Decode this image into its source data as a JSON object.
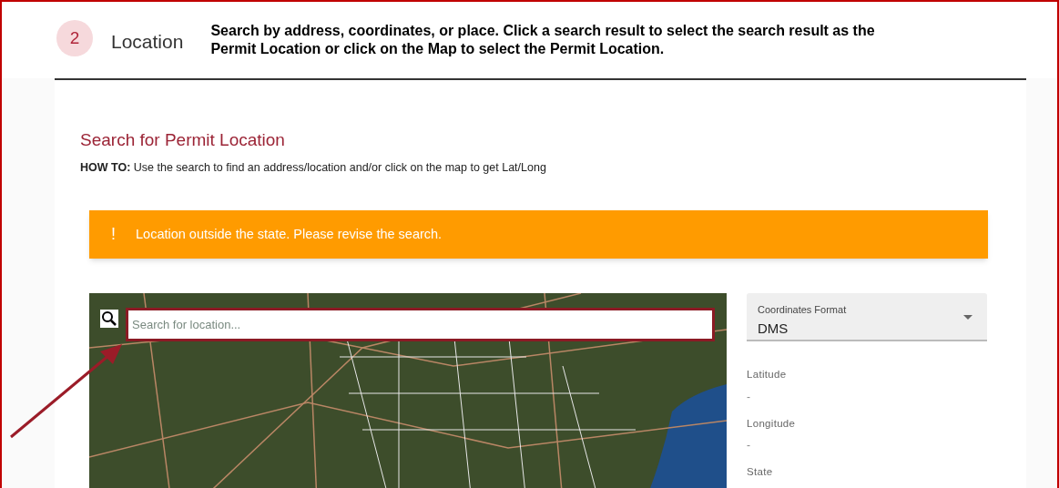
{
  "step": {
    "number": "2",
    "label": "Location"
  },
  "instructions": "Search by address, coordinates, or place. Click a search result to select the search result as the Permit Location or click on the Map to select the Permit Location.",
  "section": {
    "title": "Search for Permit Location",
    "howto": "**HOW TO:** Use the search to find an address/location and/or click on the map to get Lat/Long"
  },
  "alert": {
    "icon": "!",
    "message": "Location outside the state. Please revise the search."
  },
  "map": {
    "search": {
      "placeholder": "Search for location..."
    }
  },
  "coordinates_format": {
    "label": "Coordinates Format",
    "value": "DMS"
  },
  "fields": [
    {
      "label": "Latitude",
      "value": "-"
    },
    {
      "label": "Longitude",
      "value": "-"
    },
    {
      "label": "State"
    }
  ]
}
